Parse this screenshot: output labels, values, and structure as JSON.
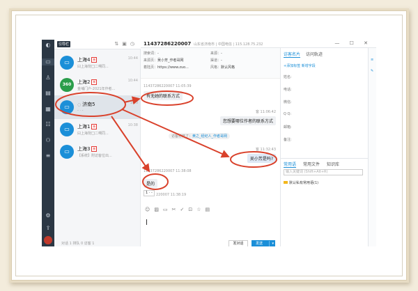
{
  "rail": {
    "icons": [
      "logo-icon",
      "chat-icon",
      "user-icon",
      "monitor-icon",
      "ticket-icon",
      "contacts-icon",
      "visitor-icon",
      "list-icon",
      "settings-icon",
      "upload-icon"
    ]
  },
  "list": {
    "tab_label": "引导栏",
    "tab_label_hidden": "",
    "items": [
      {
        "name": "上海4",
        "badge": "新",
        "preview": "曰上海背囗二嗍同...",
        "time": "10:44",
        "avatar": "monitor"
      },
      {
        "name": "上海2",
        "badge": "新",
        "preview": "金埔门户-2021年作者...",
        "time": "10:44",
        "avatar": "360"
      },
      {
        "name": "济南5",
        "badge": "",
        "preview": "- · -",
        "time": "10:3",
        "avatar": "monitor"
      },
      {
        "name": "上海1",
        "badge": "新",
        "preview": "曰上海背囗二嗍同...",
        "time": "10:38",
        "avatar": "monitor"
      },
      {
        "name": "上海3",
        "badge": "新",
        "preview": "【系统】附访客位出...",
        "time": "",
        "avatar": "monitor"
      }
    ],
    "footer": "对话 1     排队 0     访客 1"
  },
  "chat_header": {
    "visitor_id": "11437286220007",
    "location": "山东省济南市  |  中国电信  |  115.128.75.232",
    "controls": "— ☐ ✕"
  },
  "info": {
    "search_word_label": "搜索词：",
    "search_word_value": "-",
    "source_label": "来源：",
    "source_value": "-",
    "from_page_label": "来源页：",
    "from_page_value": "吴小芳_作者哥网",
    "status_label": "渠道：",
    "status_value": "-",
    "visit_page_label": "着陆页：",
    "visit_page_value": "https://www.zuo...",
    "style_label": "风格：",
    "style_value": "默认风格"
  },
  "chat": {
    "messages": [
      {
        "side": "left",
        "meta": "11437286220007 11:05:39",
        "text": "有无她的联系方式"
      },
      {
        "side": "right",
        "meta": "客 11:06:42",
        "text": "您想要哪位作者的联系方式"
      },
      {
        "side": "right",
        "meta": "客 11:32:43",
        "text": "吴小芳是吗?"
      },
      {
        "side": "left",
        "meta": "11437286220007 11:38:08",
        "text": "是的"
      },
      {
        "side": "left",
        "meta": "220007 11:38:19",
        "text": ""
      }
    ],
    "system_text": "访客打开了：",
    "system_link": "黄之_经纪人_作者哥网",
    "typing_value": "1  · -"
  },
  "toolbar": {
    "icons": [
      "emoji-icon",
      "image-icon",
      "file-icon",
      "scissors-icon",
      "check-icon",
      "bookmark-icon",
      "star-icon",
      "note-icon"
    ]
  },
  "buttons": {
    "close": "发对话",
    "send": "发送"
  },
  "right": {
    "tabs": [
      "访客名片",
      "访问轨迹"
    ],
    "actions": "+添加标签  新增字段",
    "fields": [
      "姓名:",
      "电话:",
      "微信:",
      "Q Q:",
      "邮箱:",
      "备注:"
    ],
    "tabs2": [
      "常用语",
      "常用文件",
      "知识库"
    ],
    "kw_placeholder": "输入关键词 (Shift+Alt+R)",
    "folder": "默认私有常用语(1)"
  },
  "colors": {
    "accent": "#1b8fd8",
    "rail": "#2b3744",
    "annotation": "#d9412b"
  }
}
